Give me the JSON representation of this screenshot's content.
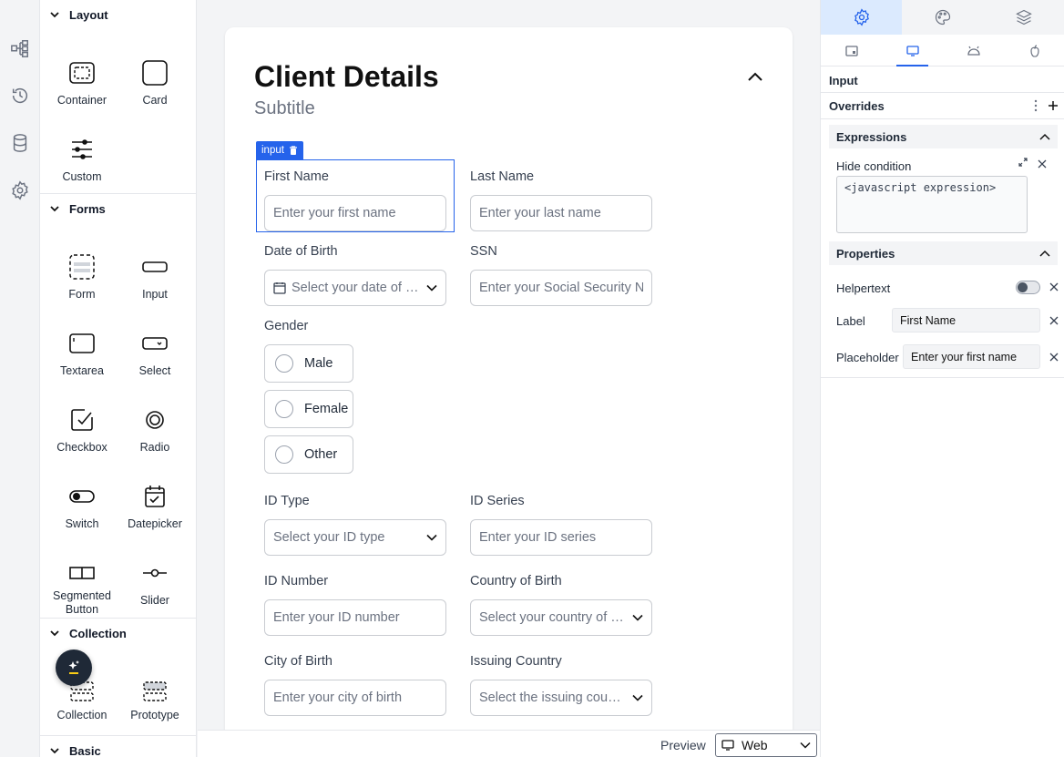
{
  "rail": {
    "icons": [
      "tree-icon",
      "history-icon",
      "database-icon",
      "settings-icon"
    ]
  },
  "palette": {
    "sections": {
      "layout": "Layout",
      "forms": "Forms",
      "collection": "Collection",
      "basic": "Basic"
    },
    "layout_items": [
      "Container",
      "Card",
      "Custom"
    ],
    "forms_items": [
      "Form",
      "Input",
      "Textarea",
      "Select",
      "Checkbox",
      "Radio",
      "Switch",
      "Datepicker",
      "Segmented Button",
      "Slider"
    ],
    "collection_items": [
      "Collection",
      "Prototype"
    ]
  },
  "card": {
    "title": "Client Details",
    "subtitle": "Subtitle",
    "selected_tag": "input",
    "fields": {
      "first_name": {
        "label": "First Name",
        "placeholder": "Enter your first name"
      },
      "last_name": {
        "label": "Last Name",
        "placeholder": "Enter your last name"
      },
      "dob": {
        "label": "Date of Birth",
        "placeholder": "Select your date of birth"
      },
      "ssn": {
        "label": "SSN",
        "placeholder": "Enter your Social Security Number"
      },
      "gender": {
        "label": "Gender",
        "options": [
          "Male",
          "Female",
          "Other"
        ]
      },
      "id_type": {
        "label": "ID Type",
        "placeholder": "Select your ID type"
      },
      "id_series": {
        "label": "ID Series",
        "placeholder": "Enter your ID series"
      },
      "id_number": {
        "label": "ID Number",
        "placeholder": "Enter your ID number"
      },
      "country_birth": {
        "label": "Country of Birth",
        "placeholder": "Select your country of birth"
      },
      "city_birth": {
        "label": "City of Birth",
        "placeholder": "Enter your city of birth"
      },
      "issuing_country": {
        "label": "Issuing Country",
        "placeholder": "Select the issuing country"
      }
    }
  },
  "preview": {
    "label": "Preview",
    "value": "Web"
  },
  "right_panel": {
    "component": "Input",
    "overrides": "Overrides",
    "expressions": "Expressions",
    "hide_condition": "Hide condition",
    "expression_placeholder": "<javascript expression>",
    "properties": "Properties",
    "helpertext": "Helpertext",
    "label_label": "Label",
    "label_value": "First Name",
    "placeholder_label": "Placeholder",
    "placeholder_value": "Enter your first name"
  },
  "colors": {
    "accent": "#2563eb",
    "fab": "#1f2937"
  }
}
